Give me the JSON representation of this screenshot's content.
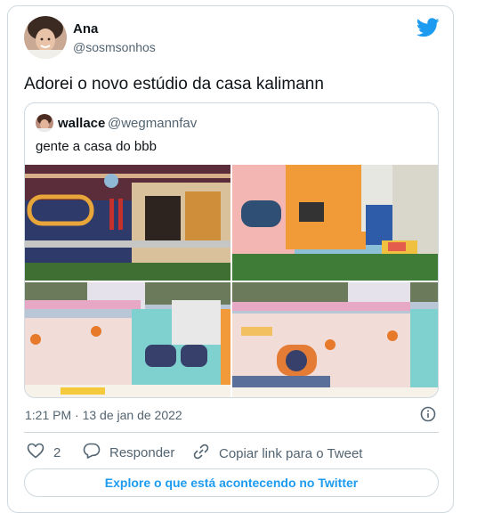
{
  "tweet": {
    "author_name": "Ana",
    "author_handle": "@sosmsonhos",
    "text": "Adorei o novo estúdio da casa kalimann",
    "timestamp": "1:21 PM · 13 de jan de 2022",
    "brand_color": "#1d9bf0"
  },
  "quoted": {
    "author_name": "wallace",
    "author_handle": "@wegmannfav",
    "text": "gente a casa do bbb"
  },
  "actions": {
    "like_count": "2",
    "reply_label": "Responder",
    "copy_link_label": "Copiar link para o Tweet"
  },
  "explore_label": "Explore o que está acontecendo no Twitter",
  "icons": [
    "twitter-bird-icon",
    "info-icon",
    "heart-icon",
    "reply-icon",
    "link-icon"
  ]
}
